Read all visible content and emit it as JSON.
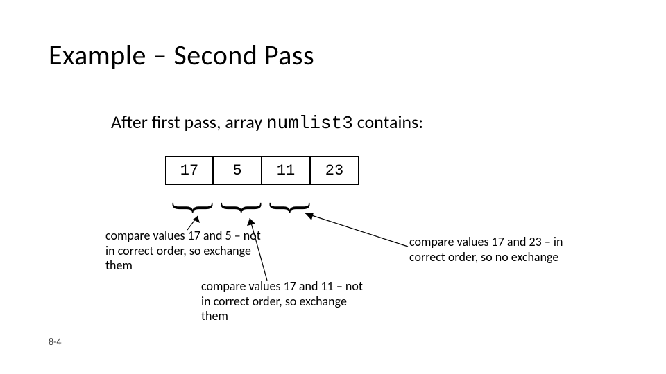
{
  "title": "Example – Second Pass",
  "subtitle_pre": "After first pass, array ",
  "subtitle_code": "numlist3",
  "subtitle_post": " contains:",
  "array": [
    "17",
    "5",
    "11",
    "23"
  ],
  "notes": {
    "n1": "compare values 17 and 5 – not in correct order, so exchange them",
    "n2": "compare values 17 and 11 – not in correct order, so exchange them",
    "n3": "compare values 17 and 23 – in correct order, so no exchange"
  },
  "slide_number": "8-4"
}
